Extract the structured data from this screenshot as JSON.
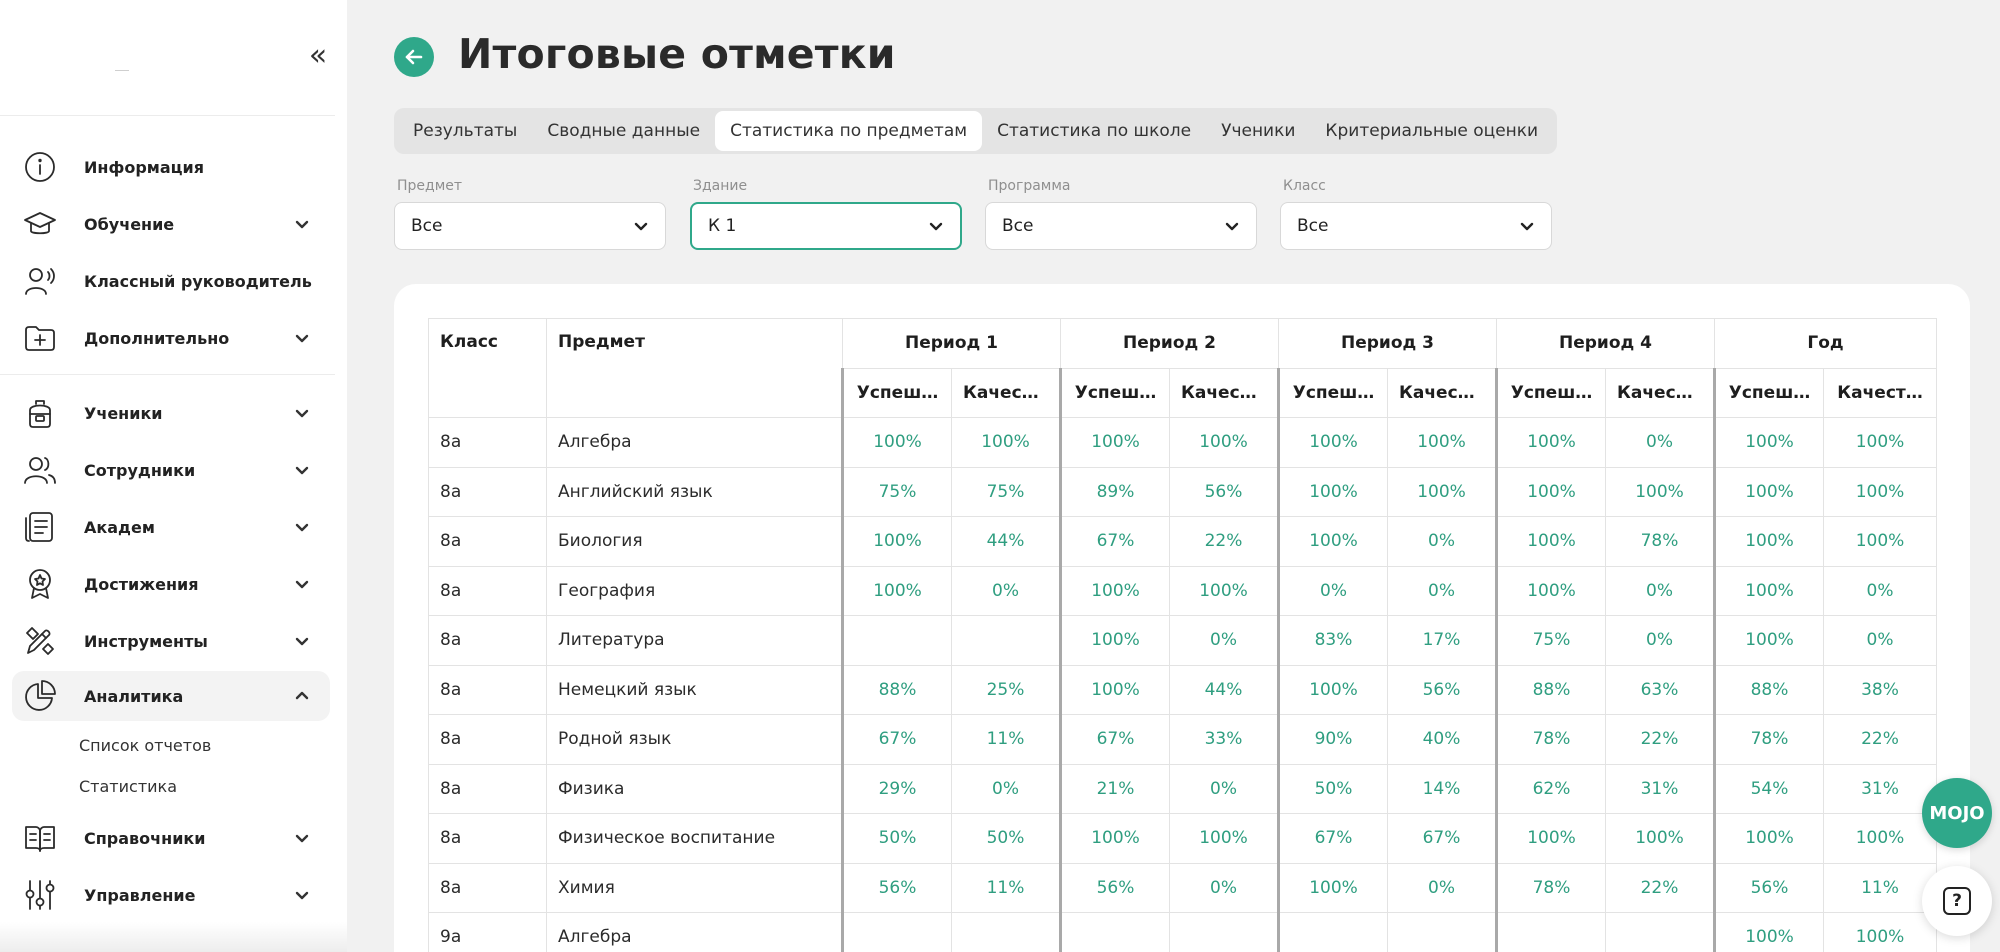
{
  "sidebar": {
    "items": [
      {
        "label": "Информация",
        "icon": "info-icon"
      },
      {
        "label": "Обучение",
        "icon": "graduation-cap-icon"
      },
      {
        "label": "Классный руководитель",
        "icon": "teacher-icon"
      },
      {
        "label": "Дополнительно",
        "icon": "folder-plus-icon"
      },
      {
        "label": "Ученики",
        "icon": "backpack-icon"
      },
      {
        "label": "Сотрудники",
        "icon": "users-icon"
      },
      {
        "label": "Академ",
        "icon": "document-icon"
      },
      {
        "label": "Достижения",
        "icon": "award-icon"
      },
      {
        "label": "Инструменты",
        "icon": "tools-icon"
      },
      {
        "label": "Аналитика",
        "icon": "pie-chart-icon"
      },
      {
        "label": "Справочники",
        "icon": "book-icon"
      },
      {
        "label": "Управление",
        "icon": "sliders-icon"
      }
    ],
    "analytics_sub": [
      "Список отчетов",
      "Статистика"
    ]
  },
  "header": {
    "title": "Итоговые отметки"
  },
  "tabs": [
    {
      "label": "Результаты"
    },
    {
      "label": "Сводные данные"
    },
    {
      "label": "Статистика по предметам"
    },
    {
      "label": "Статистика по школе"
    },
    {
      "label": "Ученики"
    },
    {
      "label": "Критериальные оценки"
    }
  ],
  "filters": {
    "subject": {
      "label": "Предмет",
      "value": "Все"
    },
    "building": {
      "label": "Здание",
      "value": "К 1"
    },
    "program": {
      "label": "Программа",
      "value": "Все"
    },
    "class": {
      "label": "Класс",
      "value": "Все"
    }
  },
  "table": {
    "col_class": "Класс",
    "col_subject": "Предмет",
    "periods": [
      "Период 1",
      "Период 2",
      "Период 3",
      "Период 4",
      "Год"
    ],
    "sub_success": "Успеш…",
    "sub_quality": "Качест…",
    "rows": [
      {
        "class": "8а",
        "subject": "Алгебра",
        "v": [
          "100%",
          "100%",
          "100%",
          "100%",
          "100%",
          "100%",
          "100%",
          "0%",
          "100%",
          "100%"
        ]
      },
      {
        "class": "8а",
        "subject": "Английский язык",
        "v": [
          "75%",
          "75%",
          "89%",
          "56%",
          "100%",
          "100%",
          "100%",
          "100%",
          "100%",
          "100%"
        ]
      },
      {
        "class": "8а",
        "subject": "Биология",
        "v": [
          "100%",
          "44%",
          "67%",
          "22%",
          "100%",
          "0%",
          "100%",
          "78%",
          "100%",
          "100%"
        ]
      },
      {
        "class": "8а",
        "subject": "География",
        "v": [
          "100%",
          "0%",
          "100%",
          "100%",
          "0%",
          "0%",
          "100%",
          "0%",
          "100%",
          "0%"
        ]
      },
      {
        "class": "8а",
        "subject": "Литература",
        "v": [
          "",
          "",
          "100%",
          "0%",
          "83%",
          "17%",
          "75%",
          "0%",
          "100%",
          "0%"
        ]
      },
      {
        "class": "8а",
        "subject": "Немецкий язык",
        "v": [
          "88%",
          "25%",
          "100%",
          "44%",
          "100%",
          "56%",
          "88%",
          "63%",
          "88%",
          "38%"
        ]
      },
      {
        "class": "8а",
        "subject": "Родной язык",
        "v": [
          "67%",
          "11%",
          "67%",
          "33%",
          "90%",
          "40%",
          "78%",
          "22%",
          "78%",
          "22%"
        ]
      },
      {
        "class": "8а",
        "subject": "Физика",
        "v": [
          "29%",
          "0%",
          "21%",
          "0%",
          "50%",
          "14%",
          "62%",
          "31%",
          "54%",
          "31%"
        ]
      },
      {
        "class": "8а",
        "subject": "Физическое воспитание",
        "v": [
          "50%",
          "50%",
          "100%",
          "100%",
          "67%",
          "67%",
          "100%",
          "100%",
          "100%",
          "100%"
        ]
      },
      {
        "class": "8а",
        "subject": "Химия",
        "v": [
          "56%",
          "11%",
          "56%",
          "0%",
          "100%",
          "0%",
          "78%",
          "22%",
          "56%",
          "11%"
        ]
      },
      {
        "class": "9а",
        "subject": "Алгебра",
        "v": [
          "",
          "",
          "",
          "",
          "",
          "",
          "",
          "",
          "100%",
          "100%"
        ]
      }
    ]
  },
  "floating": {
    "mojo_label": "MOJO",
    "help_label": "?"
  },
  "colors": {
    "accent": "#2fa88a",
    "value_text": "#2f9e80"
  }
}
